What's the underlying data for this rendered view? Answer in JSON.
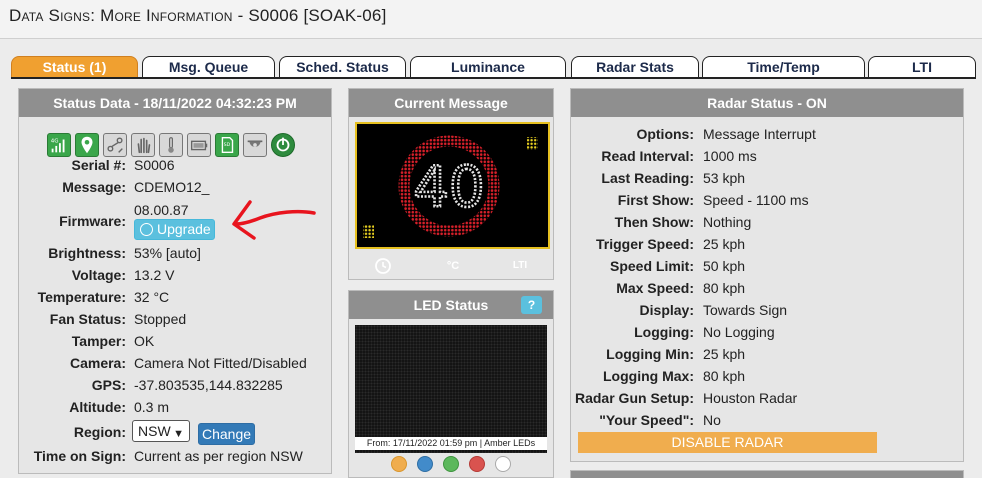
{
  "page": {
    "title": "Data Signs: More Information - S0006 [SOAK-06]"
  },
  "tabs": [
    {
      "label": "Status (1)",
      "active": true
    },
    {
      "label": "Msg. Queue"
    },
    {
      "label": "Sched. Status"
    },
    {
      "label": "Luminance"
    },
    {
      "label": "Radar Stats"
    },
    {
      "label": "Time/Temp"
    },
    {
      "label": "LTI"
    }
  ],
  "status_panel": {
    "title": "Status Data - 18/11/2022 04:32:23 PM",
    "icons": [
      "signal-4g-icon",
      "location-pin-icon",
      "gps-route-icon",
      "tamper-hand-icon",
      "thermometer-icon",
      "battery-icon",
      "sd-card-icon",
      "camera-dome-icon",
      "power-icon"
    ],
    "serial_label": "Serial #:",
    "serial_value": "S0006",
    "message_label": "Message:",
    "message_value": "CDEMO12_",
    "firmware_label": "Firmware:",
    "firmware_value": "08.00.87",
    "upgrade_label": "Upgrade",
    "brightness_label": "Brightness:",
    "brightness_value": "53% [auto]",
    "voltage_label": "Voltage:",
    "voltage_value": "13.2 V",
    "temperature_label": "Temperature:",
    "temperature_value": "32 °C",
    "fan_label": "Fan Status:",
    "fan_value": "Stopped",
    "tamper_label": "Tamper:",
    "tamper_value": "OK",
    "camera_label": "Camera:",
    "camera_value": "Camera Not Fitted/Disabled",
    "gps_label": "GPS:",
    "gps_value": "-37.803535,144.832285",
    "altitude_label": "Altitude:",
    "altitude_value": "0.3 m",
    "region_label": "Region:",
    "region_value": "NSW",
    "change_label": "Change",
    "time_label": "Time on Sign:",
    "time_value": "Current as per region NSW"
  },
  "current_message": {
    "title": "Current Message",
    "sign_text": "40",
    "footer_icons": [
      {
        "icon": "clock-icon",
        "label": ""
      },
      {
        "icon": "celsius-icon",
        "label": "°C"
      },
      {
        "icon": "lti-icon",
        "label": "LTI"
      }
    ]
  },
  "led_status": {
    "title": "LED Status",
    "help_label": "?",
    "caption": "From: 17/11/2022 01:59 pm | Amber LEDs",
    "dots": [
      "#f0ad4e",
      "#428bca",
      "#5cb85c",
      "#d9534f",
      "#ffffff"
    ]
  },
  "radar": {
    "title": "Radar Status - ON",
    "rows": [
      {
        "label": "Options:",
        "value": "Message Interrupt"
      },
      {
        "label": "Read Interval:",
        "value": "1000 ms"
      },
      {
        "label": "Last Reading:",
        "value": "53 kph"
      },
      {
        "label": "First Show:",
        "value": "Speed - 1100 ms"
      },
      {
        "label": "Then Show:",
        "value": "Nothing"
      },
      {
        "label": "Trigger Speed:",
        "value": "25 kph"
      },
      {
        "label": "Speed Limit:",
        "value": "50 kph"
      },
      {
        "label": "Max Speed:",
        "value": "80 kph"
      },
      {
        "label": "Display:",
        "value": "Towards Sign"
      },
      {
        "label": "Logging:",
        "value": "No Logging"
      },
      {
        "label": "Logging Min:",
        "value": "25 kph"
      },
      {
        "label": "Logging Max:",
        "value": "80 kph"
      },
      {
        "label": "Radar Gun Setup:",
        "value": "Houston Radar"
      },
      {
        "label": "\"Your Speed\":",
        "value": "No"
      }
    ],
    "disable_label": "DISABLE RADAR"
  },
  "colors": {
    "active_tab": "#f0a030",
    "panel_header": "#8f8f8f",
    "upgrade_button": "#5bc0de",
    "change_button": "#337ab7",
    "disable_button": "#f0ad4e",
    "annotation_arrow": "#e8141e"
  }
}
